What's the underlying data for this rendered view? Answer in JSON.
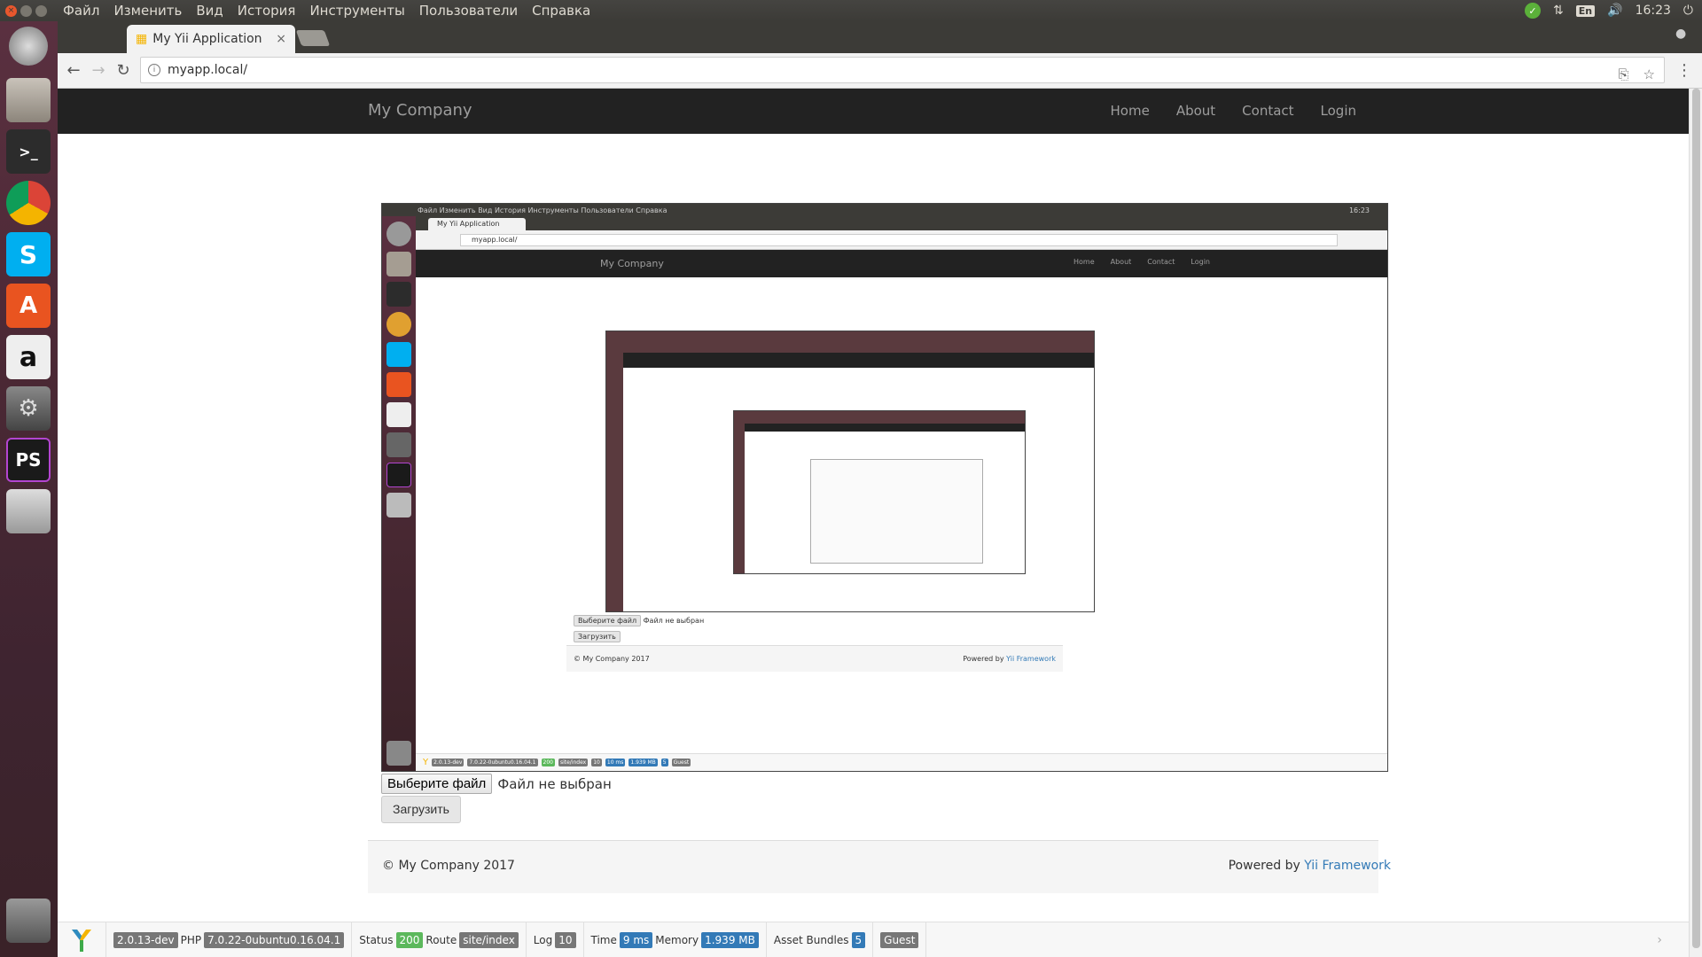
{
  "os": {
    "menu": [
      "Файл",
      "Изменить",
      "Вид",
      "История",
      "Инструменты",
      "Пользователи",
      "Справка"
    ],
    "lang": "En",
    "time": "16:23"
  },
  "launcher": {
    "items": [
      "ubuntu-dash-icon",
      "files-icon",
      "terminal-icon",
      "chrome-icon",
      "skype-icon",
      "software-center-icon",
      "amazon-icon",
      "system-settings-icon",
      "phpstorm-icon",
      "drive-icon",
      "trash-icon"
    ]
  },
  "browser": {
    "tab_title": "My Yii Application",
    "url": "myapp.local/"
  },
  "navbar": {
    "brand": "My Company",
    "links": [
      "Home",
      "About",
      "Contact",
      "Login"
    ]
  },
  "screenshot": {
    "os_menu": "Файл  Изменить  Вид  История  Инструменты  Пользователи  Справка",
    "time": "16:23",
    "tab_title": "My Yii Application",
    "url": "myapp.local/",
    "brand": "My Company",
    "links": [
      "Home",
      "About",
      "Contact",
      "Login"
    ],
    "file_button": "Выберите файл",
    "no_file": "Файл не выбран",
    "submit": "Загрузить",
    "copyright": "© My Company 2017",
    "powered_prefix": "Powered by",
    "powered_link": "Yii Framework",
    "debug": {
      "version": "2.0.13-dev",
      "php": "7.0.22-0ubuntu0.16.04.1",
      "status_code": "200",
      "route": "site/index",
      "log": "10",
      "time": "10 ms",
      "memory": "1.939 MB",
      "bundles": "5",
      "user": "Guest"
    }
  },
  "upload": {
    "file_button": "Выберите файл",
    "no_file": "Файл не выбран",
    "submit": "Загрузить"
  },
  "footer": {
    "copyright": "© My Company 2017",
    "powered_prefix": "Powered by",
    "powered_link": "Yii Framework"
  },
  "debug": {
    "version": "2.0.13-dev",
    "php_label": "PHP",
    "php_version": "7.0.22-0ubuntu0.16.04.1",
    "status_label": "Status",
    "status_code": "200",
    "route_label": "Route",
    "route": "site/index",
    "log_label": "Log",
    "log_count": "10",
    "time_label": "Time",
    "time_value": "9 ms",
    "memory_label": "Memory",
    "memory_value": "1.939 MB",
    "bundles_label": "Asset Bundles",
    "bundles_count": "5",
    "user": "Guest"
  },
  "colors": {
    "navbar_bg": "#222222",
    "link": "#337ab7",
    "status_ok": "#5cb85c",
    "label_info": "#337ab7",
    "os_bar": "#3c3b37"
  }
}
